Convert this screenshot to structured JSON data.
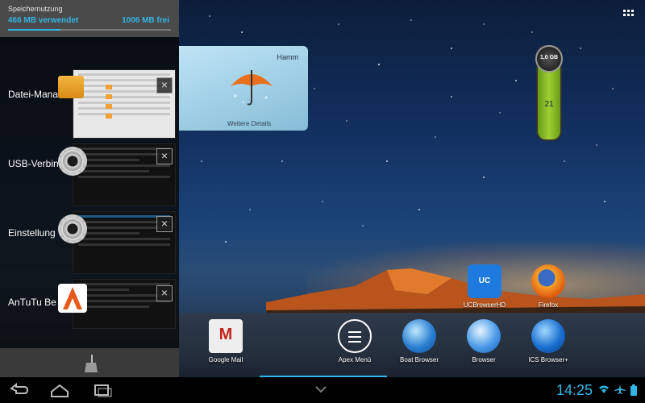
{
  "memory": {
    "title": "Speichernutzung",
    "used": "466 MB verwendet",
    "free": "1006 MB frei",
    "used_fraction": 0.32
  },
  "recents": [
    {
      "label": "Datei-Mana",
      "icon": "files-icon",
      "close": "×"
    },
    {
      "label": "USB-Verbin",
      "icon": "gear-icon",
      "close": "×"
    },
    {
      "label": "Einstellung",
      "icon": "gear-icon",
      "close": "×"
    },
    {
      "label": "AnTuTu Be",
      "icon": "antutu-icon",
      "close": "×"
    }
  ],
  "weather": {
    "city": "Hamm",
    "link": "Weitere Details"
  },
  "mem_widget": {
    "cap": "1,0 GB",
    "value": "21"
  },
  "desktop": {
    "ucbrowser": "UCBrowserHD",
    "firefox": "Firefox",
    "gmail": "Google Mail",
    "apex": "Apex Menü",
    "boat": "Boat Browser",
    "browser": "Browser",
    "ics": "ICS Browser+"
  },
  "uc_icon_text": "UC",
  "clock": "14:25",
  "colors": {
    "accent": "#33b5e5"
  }
}
